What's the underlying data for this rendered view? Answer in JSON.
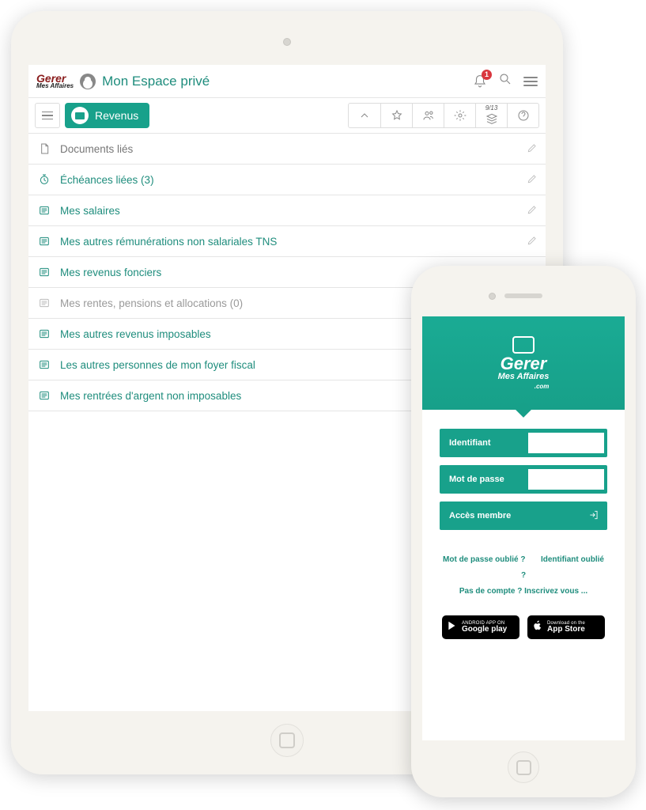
{
  "tablet": {
    "logo": {
      "line1": "Gerer",
      "line2": "Mes Affaires"
    },
    "page_title": "Mon Espace privé",
    "notifications_count": "1",
    "pill_label": "Revenus",
    "stack_count": "9/13",
    "rows": [
      {
        "label": "Documents liés",
        "icon": "document",
        "style": "dim",
        "edit": true
      },
      {
        "label": "Échéances liées (3)",
        "icon": "clock",
        "style": "teal",
        "edit": true
      },
      {
        "label": "Mes salaires",
        "icon": "list",
        "style": "teal",
        "edit": true
      },
      {
        "label": "Mes autres rémunérations non salariales TNS",
        "icon": "list",
        "style": "teal",
        "edit": true
      },
      {
        "label": "Mes revenus fonciers",
        "icon": "list",
        "style": "teal",
        "edit": true
      },
      {
        "label": "Mes rentes, pensions et allocations (0)",
        "icon": "list",
        "style": "muted",
        "edit": false
      },
      {
        "label": "Mes autres revenus imposables",
        "icon": "list",
        "style": "teal",
        "edit": false
      },
      {
        "label": "Les autres personnes de mon foyer fiscal",
        "icon": "list",
        "style": "teal",
        "edit": false
      },
      {
        "label": "Mes rentrées d'argent non imposables",
        "icon": "list",
        "style": "teal",
        "edit": false
      }
    ]
  },
  "phone": {
    "logo": {
      "line1": "Gerer",
      "line2": "Mes Affaires",
      "line3": ".com"
    },
    "identifiant_label": "Identifiant",
    "password_label": "Mot de passe",
    "access_label": "Accès membre",
    "link_forgot_pw": "Mot de passe oublié ?",
    "link_forgot_id": "Identifiant oublié ?",
    "link_signup": "Pas de compte ? Inscrivez vous ...",
    "google": {
      "t1": "ANDROID APP ON",
      "t2": "Google play"
    },
    "apple": {
      "t1": "Download on the",
      "t2": "App Store"
    }
  }
}
